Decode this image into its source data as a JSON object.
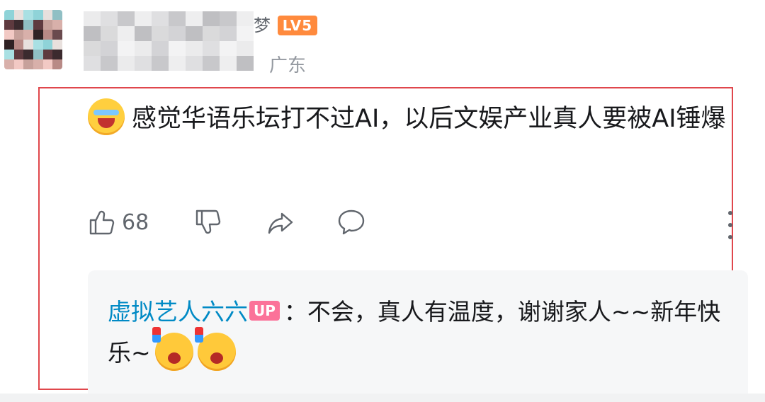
{
  "header": {
    "name_tail": "梦",
    "level": "LV5",
    "location": "广东"
  },
  "comment": {
    "text": "感觉华语乐坛打不过AI，以后文娱产业真人要被AI锤爆",
    "emoji_icon": "laughing-crying-emoji-icon",
    "likes": "68"
  },
  "reply": {
    "user": "虚拟艺人六六",
    "badge": "UP",
    "text": "：不会，真人有温度，谢谢家人~~新年快乐~",
    "emoji_icon": "cheering-emoji-icon"
  },
  "colors": {
    "accent_link": "#008ac5",
    "up_badge": "#fb7299",
    "level_badge": "#ff8a3d",
    "highlight_border": "#e0474c"
  }
}
